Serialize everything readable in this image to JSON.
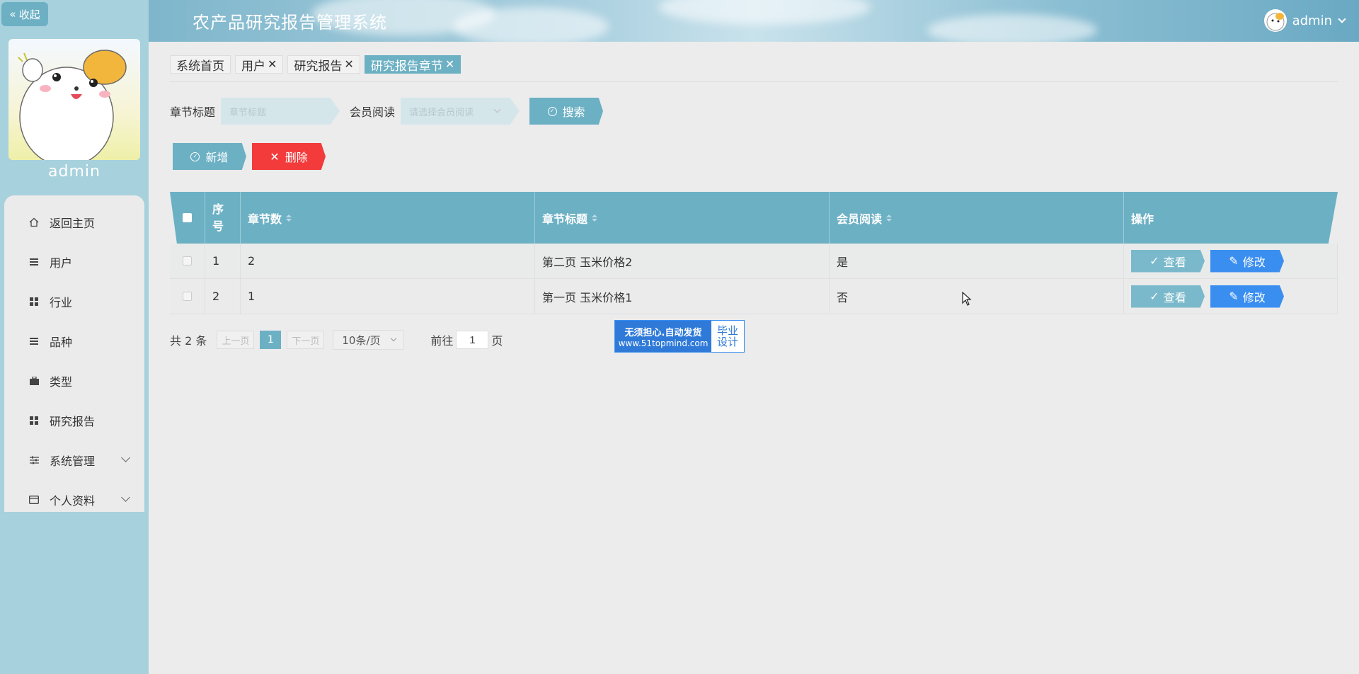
{
  "sidebar": {
    "collapse_label": "收起",
    "username": "admin",
    "items": [
      {
        "label": "返回主页",
        "icon": "home-icon"
      },
      {
        "label": "用户",
        "icon": "list-icon"
      },
      {
        "label": "行业",
        "icon": "grid-icon"
      },
      {
        "label": "品种",
        "icon": "list-icon"
      },
      {
        "label": "类型",
        "icon": "briefcase-icon"
      },
      {
        "label": "研究报告",
        "icon": "grid-icon"
      },
      {
        "label": "系统管理",
        "icon": "sliders-icon",
        "expandable": true
      },
      {
        "label": "个人资料",
        "icon": "card-icon",
        "expandable": true
      }
    ]
  },
  "header": {
    "title": "农产品研究报告管理系统",
    "user": "admin"
  },
  "tabs": [
    {
      "label": "系统首页",
      "closable": false,
      "active": false
    },
    {
      "label": "用户",
      "closable": true,
      "active": false
    },
    {
      "label": "研究报告",
      "closable": true,
      "active": false
    },
    {
      "label": "研究报告章节",
      "closable": true,
      "active": true
    }
  ],
  "search": {
    "title_label": "章节标题",
    "title_placeholder": "章节标题",
    "member_label": "会员阅读",
    "member_placeholder": "请选择会员阅读",
    "search_button": "搜索"
  },
  "actions": {
    "add": "新增",
    "delete": "删除"
  },
  "table": {
    "headers": {
      "index": "序号",
      "chapter_num": "章节数",
      "chapter_title": "章节标题",
      "member_read": "会员阅读",
      "ops": "操作"
    },
    "rows": [
      {
        "index": "1",
        "chapter_num": "2",
        "chapter_title": "第二页 玉米价格2",
        "member_read": "是"
      },
      {
        "index": "2",
        "chapter_num": "1",
        "chapter_title": "第一页 玉米价格1",
        "member_read": "否"
      }
    ],
    "view_label": "查看",
    "edit_label": "修改"
  },
  "pager": {
    "total": "共 2 条",
    "prev": "上一页",
    "current": "1",
    "next": "下一页",
    "page_size": "10条/页",
    "goto_prefix": "前往",
    "goto_value": "1",
    "goto_suffix": "页"
  },
  "badge": {
    "line1": "无须担心.自动发货",
    "line2": "www.51topmind.com",
    "right1": "毕业",
    "right2": "设计"
  },
  "colors": {
    "accent": "#6cb0c4",
    "danger": "#f33b3b",
    "primary": "#3a8ef0",
    "sidebar_bg": "#a7d1dc"
  }
}
